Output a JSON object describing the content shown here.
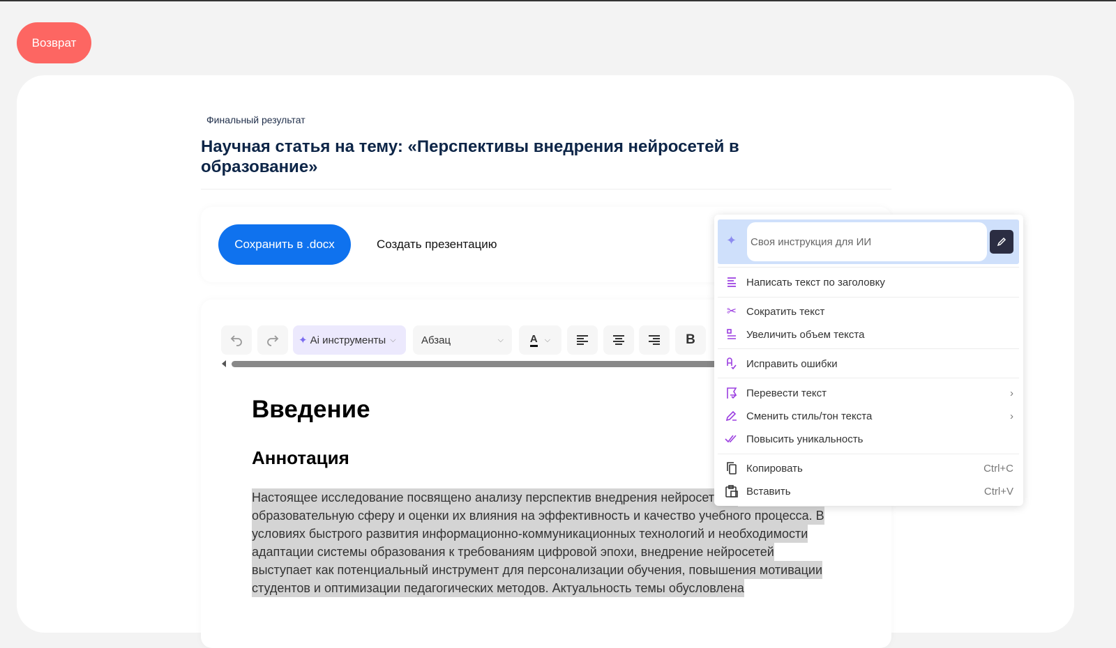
{
  "back_label": "Возврат",
  "subtitle": "Финальный результат",
  "title": "Научная статья на тему: «Перспективы внедрения нейросетей в образование»",
  "actions": {
    "save": "Сохранить в .docx",
    "presentation": "Создать презентацию"
  },
  "toolbar": {
    "ai_tools": "Ai инструменты",
    "paragraph_style": "Абзац",
    "bold": "B"
  },
  "doc": {
    "h1": "Введение",
    "h2": "Аннотация",
    "lines": [
      "Настоящее исследование посвящено анализу перспектив внедрения нейросетей в",
      "образовательную сферу и оценки их влияния на эффективность и качество учебного процесса. В",
      "условиях быстрого развития информационно-коммуникационных технологий и необходимости",
      "адаптации системы образования к требованиям цифровой эпохи, внедрение нейросетей",
      "выступает как потенциальный инструмент для персонализации обучения, повышения мотивации",
      "студентов и оптимизации педагогических методов. Актуальность темы обусловлена"
    ]
  },
  "menu": {
    "ai_placeholder": "Своя инструкция для ИИ",
    "items": [
      {
        "label": "Написать текст по заголовку",
        "icon": "lines-icon"
      },
      {
        "label": "Сократить текст",
        "icon": "scissors-icon"
      },
      {
        "label": "Увеличить объем текста",
        "icon": "expand-icon"
      },
      {
        "label": "Исправить ошибки",
        "icon": "spellcheck-icon"
      },
      {
        "label": "Перевести текст",
        "icon": "translate-icon"
      },
      {
        "label": "Сменить стиль/тон текста",
        "icon": "pencil-icon"
      },
      {
        "label": "Повысить уникальность",
        "icon": "double-check-icon"
      },
      {
        "label": "Копировать",
        "shortcut": "Ctrl+C",
        "icon": "copy-icon"
      },
      {
        "label": "Вставить",
        "shortcut": "Ctrl+V",
        "icon": "paste-icon"
      }
    ]
  },
  "colors": {
    "accent": "#0f72ee",
    "back": "#fd6662",
    "icon": "#9b3ee0"
  }
}
